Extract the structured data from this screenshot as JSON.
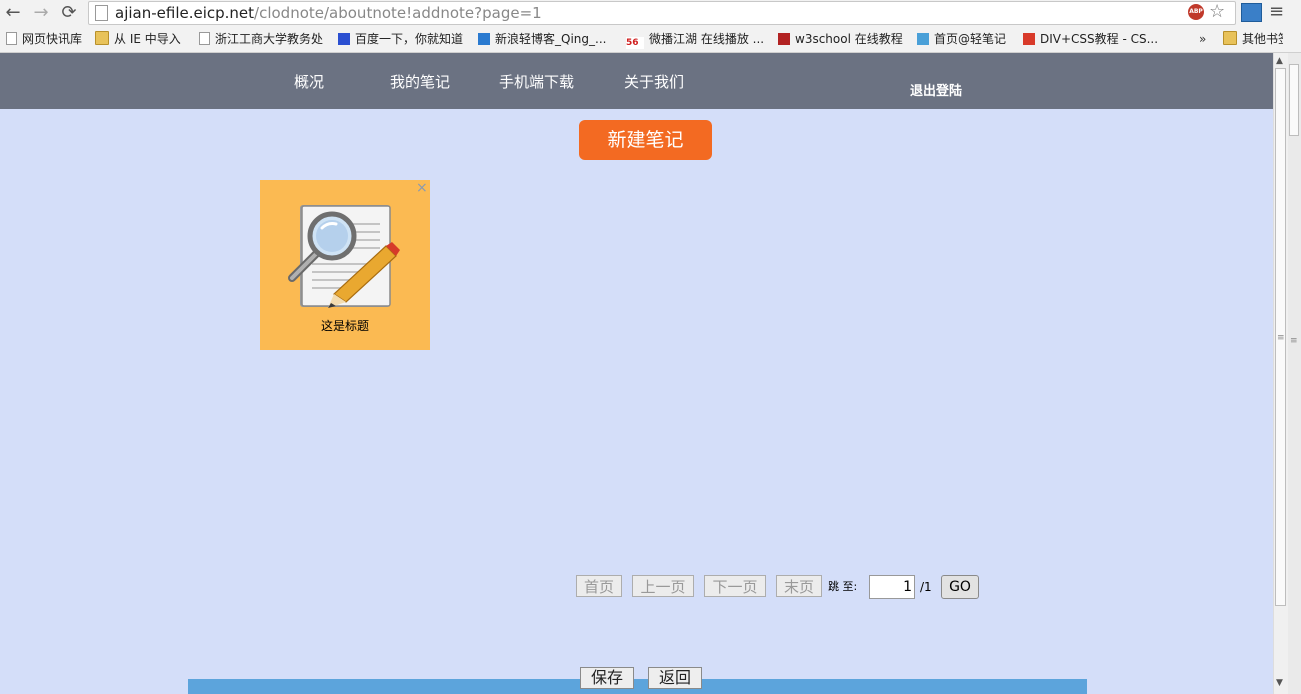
{
  "browser": {
    "url_host": "ajian-efile.eicp.net",
    "url_path": "/clodnote/aboutnote!addnote?page=1",
    "abp_label": "ABP",
    "back_icon": "←",
    "forward_icon": "→",
    "reload_icon": "⟳",
    "star_icon": "☆",
    "menu_icon": "≡",
    "bookmarks": [
      {
        "label": "网页快讯库",
        "icon": "page-icon"
      },
      {
        "label": "从 IE 中导入",
        "icon": "folder-icon"
      },
      {
        "label": "浙江工商大学教务处",
        "icon": "page-icon"
      },
      {
        "label": "百度一下，你就知道",
        "icon": "baidu-icon"
      },
      {
        "label": "新浪轻博客_Qing_...",
        "icon": "qing-icon"
      },
      {
        "label": "微播江湖 在线播放 ...",
        "icon": "56-icon",
        "icon_text": "56"
      },
      {
        "label": "w3school 在线教程",
        "icon": "w3-icon"
      },
      {
        "label": "首页@轻笔记",
        "icon": "cloud-icon"
      },
      {
        "label": "DIV+CSS教程 - CS...",
        "icon": "five-icon"
      },
      {
        "label": "其他书签",
        "icon": "folder-icon"
      }
    ],
    "bookmarks_more": "»"
  },
  "nav": {
    "items": [
      "概况",
      "我的笔记",
      "手机端下载",
      "关于我们"
    ],
    "logout": "退出登陆"
  },
  "new_note_label": "新建笔记",
  "notes": [
    {
      "title": "这是标题",
      "close": "×",
      "icon": "note-magnifier-pencil-icon"
    }
  ],
  "pagination": {
    "first": "首页",
    "prev": "上一页",
    "next": "下一页",
    "last": "末页",
    "jump_label": "跳 至:",
    "page_value": "1",
    "total": "/1",
    "go": "GO"
  },
  "editor_buttons": {
    "save": "保存",
    "back": "返回"
  },
  "colors": {
    "nav_bg": "#6b7282",
    "page_bg": "#d4def9",
    "new_button": "#f36a22",
    "note_card": "#fbba52"
  }
}
